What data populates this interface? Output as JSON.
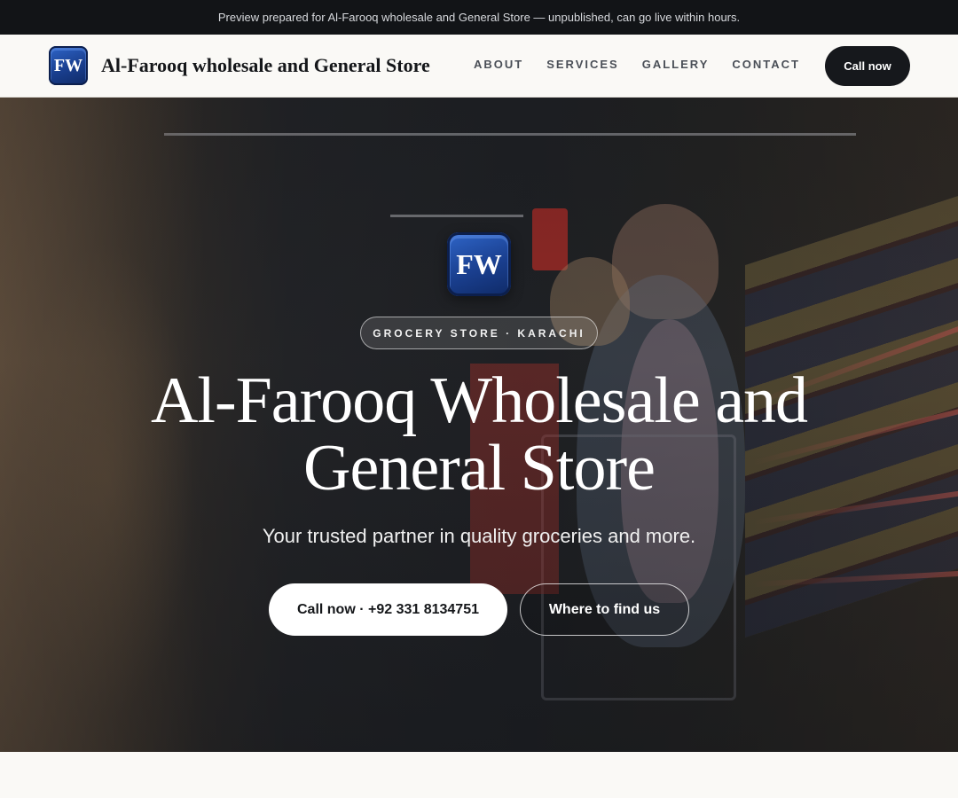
{
  "preview_banner": {
    "text": "Preview prepared for Al-Farooq wholesale and General Store — unpublished, can go live within hours."
  },
  "header": {
    "logo_text": "FW",
    "brand_name": "Al-Farooq wholesale and General Store",
    "nav": [
      {
        "label": "ABOUT"
      },
      {
        "label": "SERVICES"
      },
      {
        "label": "GALLERY"
      },
      {
        "label": "CONTACT"
      }
    ],
    "cta_label": "Call now"
  },
  "hero": {
    "logo_text": "FW",
    "tag": "GROCERY STORE · KARACHI",
    "title": "Al-Farooq Wholesale and General Store",
    "subtitle": "Your trusted partner in quality groceries and more.",
    "primary_button": "Call now · +92 331 8134751",
    "secondary_button": "Where to find us",
    "background_image": "family-in-supermarket-photo"
  },
  "colors": {
    "banner_bg": "#121417",
    "nav_bg": "#faf9f6",
    "dark_button": "#16181c",
    "logo_blue": "#1a3f8f"
  }
}
